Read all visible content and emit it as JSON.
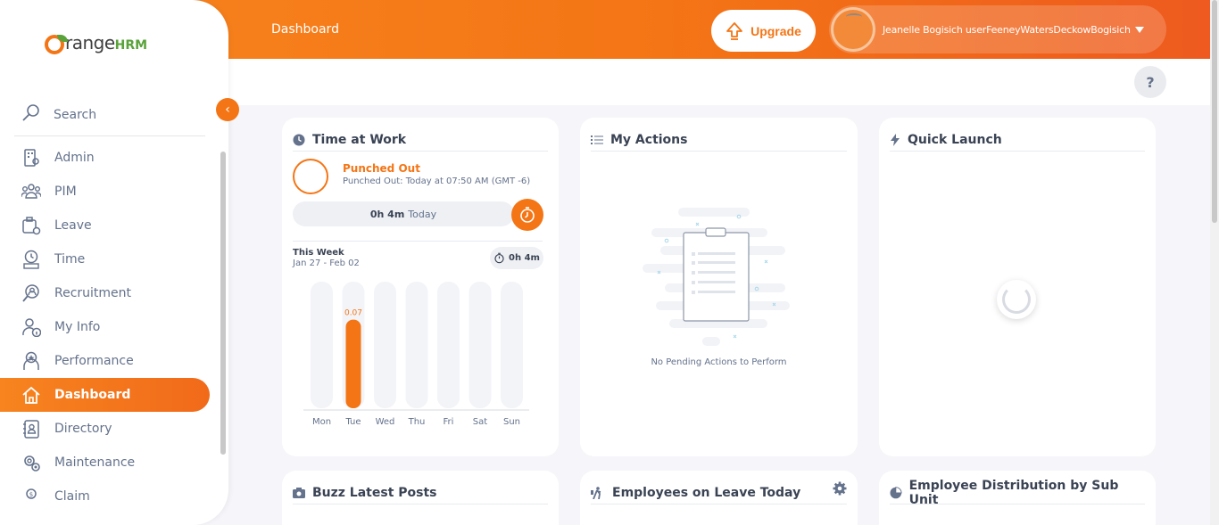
{
  "topbar": {
    "title": "Dashboard",
    "upgrade_label": "Upgrade",
    "user_name": "Jeanelle Bogisich userFeeneyWatersDeckowBogisich"
  },
  "help_label": "?",
  "sidebar": {
    "logo_text": "range",
    "logo_suffix": "HRM",
    "search_label": "Search",
    "items": [
      {
        "label": "Admin",
        "icon": "admin-icon"
      },
      {
        "label": "PIM",
        "icon": "pim-icon"
      },
      {
        "label": "Leave",
        "icon": "leave-icon"
      },
      {
        "label": "Time",
        "icon": "time-icon"
      },
      {
        "label": "Recruitment",
        "icon": "recruitment-icon"
      },
      {
        "label": "My Info",
        "icon": "my-info-icon"
      },
      {
        "label": "Performance",
        "icon": "performance-icon"
      },
      {
        "label": "Dashboard",
        "icon": "home-icon",
        "active": true
      },
      {
        "label": "Directory",
        "icon": "directory-icon"
      },
      {
        "label": "Maintenance",
        "icon": "maintenance-icon"
      },
      {
        "label": "Claim",
        "icon": "claim-icon"
      }
    ]
  },
  "time_at_work": {
    "title": "Time at Work",
    "status": "Punched Out",
    "status_detail": "Punched Out: Today at 07:50 AM (GMT -6)",
    "today_duration": "0h 4m",
    "today_label": "Today",
    "week_title": "This Week",
    "week_range": "Jan 27 - Feb 02",
    "week_total": "0h 4m"
  },
  "chart_data": {
    "type": "bar",
    "categories": [
      "Mon",
      "Tue",
      "Wed",
      "Thu",
      "Fri",
      "Sat",
      "Sun"
    ],
    "values": [
      0,
      0.07,
      0,
      0,
      0,
      0,
      0
    ],
    "data_labels": [
      "",
      "0.07",
      "",
      "",
      "",
      "",
      ""
    ],
    "ylim": [
      0,
      0.1
    ],
    "bar_color": "#f47515",
    "track_color": "#f3f4f8"
  },
  "my_actions": {
    "title": "My Actions",
    "empty_text": "No Pending Actions to Perform"
  },
  "quick_launch": {
    "title": "Quick Launch"
  },
  "buzz": {
    "title": "Buzz Latest Posts"
  },
  "leave_today": {
    "title": "Employees on Leave Today"
  },
  "distribution": {
    "title": "Employee Distribution by Sub Unit"
  },
  "colors": {
    "accent": "#f47515",
    "brand_green": "#5aa23a"
  }
}
